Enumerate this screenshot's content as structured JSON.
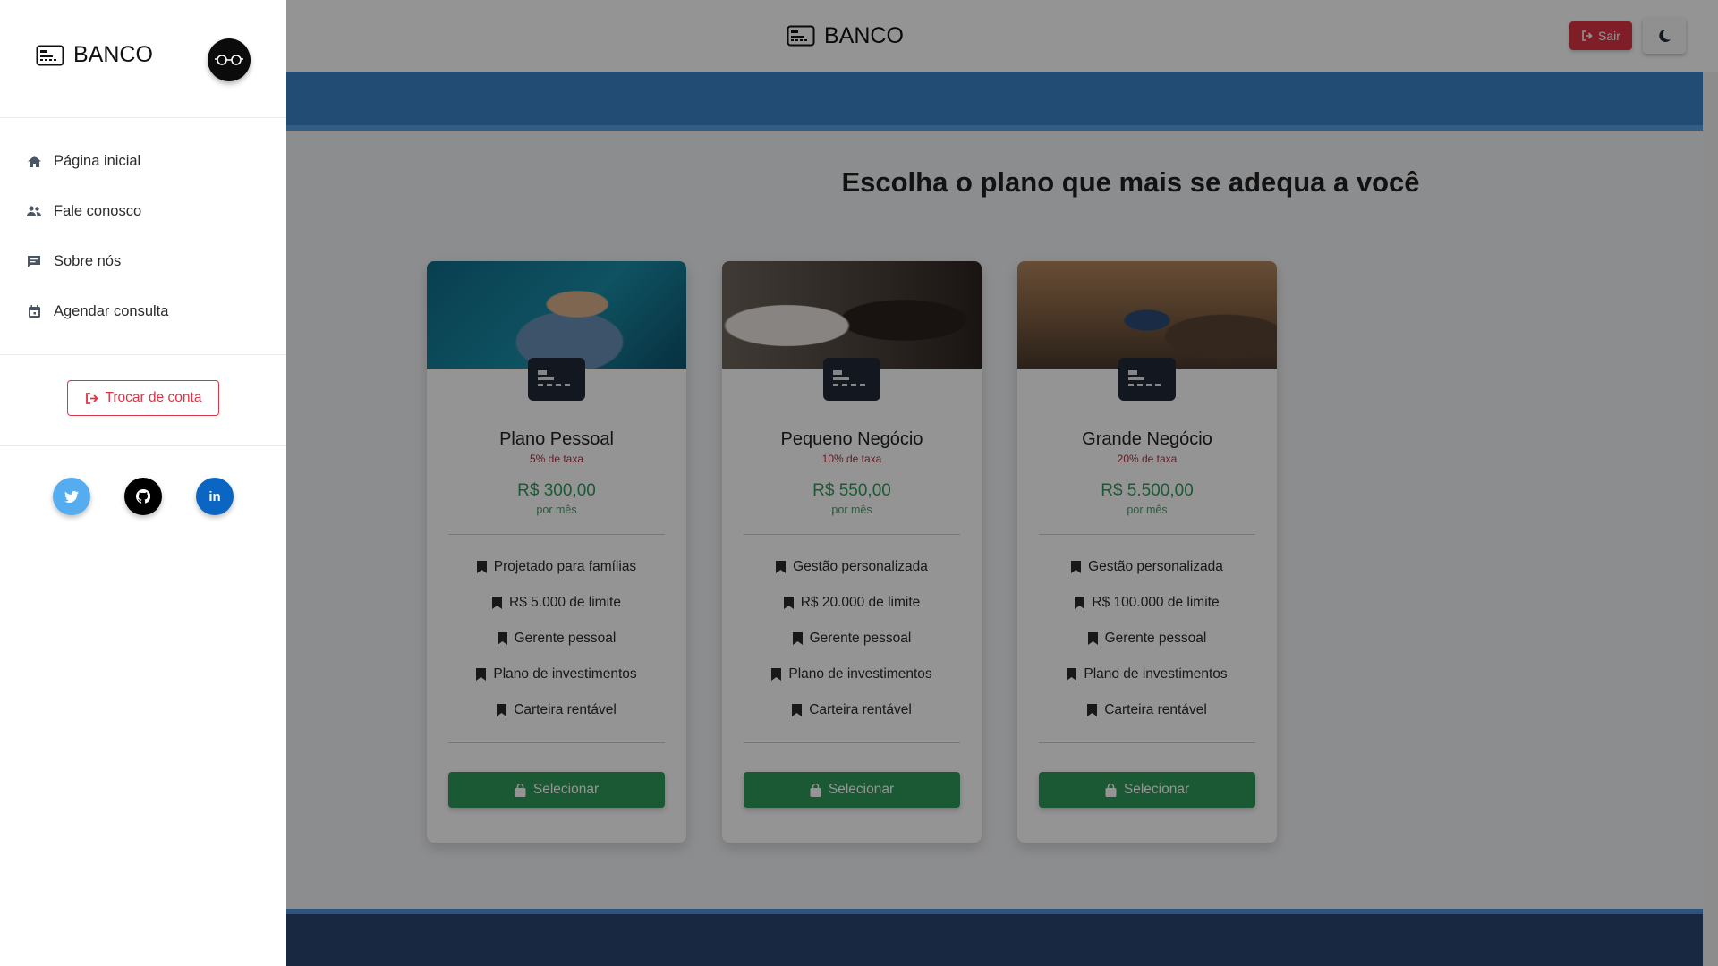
{
  "app": {
    "brand": "BANCO"
  },
  "header": {
    "logout_label": "Sair",
    "theme_icon": "moon-icon"
  },
  "page": {
    "heading": "Escolha o plano que mais se adequa a você"
  },
  "plans": [
    {
      "name": "Plano Pessoal",
      "fee": "5% de taxa",
      "price": "R$ 300,00",
      "period": "por mês",
      "features": [
        "Projetado para famílias",
        "R$ 5.000 de limite",
        "Gerente pessoal",
        "Plano de investimentos",
        "Carteira rentável"
      ],
      "select_label": "Selecionar"
    },
    {
      "name": "Pequeno Negócio",
      "fee": "10% de taxa",
      "price": "R$ 550,00",
      "period": "por mês",
      "features": [
        "Gestão personalizada",
        "R$ 20.000 de limite",
        "Gerente pessoal",
        "Plano de investimentos",
        "Carteira rentável"
      ],
      "select_label": "Selecionar"
    },
    {
      "name": "Grande Negócio",
      "fee": "20% de taxa",
      "price": "R$ 5.500,00",
      "period": "por mês",
      "features": [
        "Gestão personalizada",
        "R$ 100.000 de limite",
        "Gerente pessoal",
        "Plano de investimentos",
        "Carteira rentável"
      ],
      "select_label": "Selecionar"
    }
  ],
  "sidebar": {
    "brand": "BANCO",
    "items": [
      {
        "label": "Página inicial",
        "icon": "home-icon"
      },
      {
        "label": "Fale conosco",
        "icon": "users-icon"
      },
      {
        "label": "Sobre nós",
        "icon": "comment-icon"
      },
      {
        "label": "Agendar consulta",
        "icon": "calendar-icon"
      }
    ],
    "switch_account_label": "Trocar de conta",
    "social": [
      {
        "name": "twitter",
        "icon": "twitter-icon"
      },
      {
        "name": "github",
        "icon": "github-icon"
      },
      {
        "name": "linkedin",
        "icon": "linkedin-icon",
        "text": "in"
      }
    ]
  },
  "colors": {
    "danger": "#dc3545",
    "success": "#2f9a5a",
    "primary": "#3c83c8",
    "dark": "#1f2937"
  }
}
